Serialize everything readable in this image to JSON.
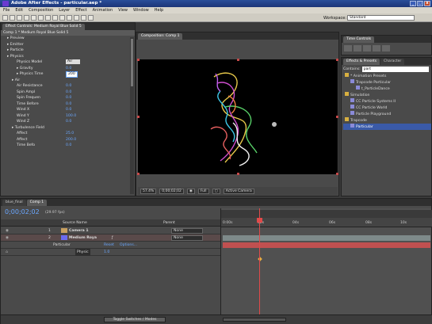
{
  "window": {
    "title": "Adobe After Effects - particular.aep *",
    "min": "_",
    "max": "□",
    "close": "x"
  },
  "menu": [
    "File",
    "Edit",
    "Composition",
    "Layer",
    "Effect",
    "Animation",
    "View",
    "Window",
    "Help"
  ],
  "toolbar": {
    "workspace_label": "Workspace:",
    "workspace_value": "Standard"
  },
  "effect_controls": {
    "tabs": [
      "Effect Controls: Medium Royal Blue Solid 5"
    ],
    "header": "Comp 1 * Medium Royal Blue Solid 5",
    "rows": [
      {
        "label": "Preview",
        "value": ""
      },
      {
        "label": "Emitter",
        "value": ""
      },
      {
        "label": "Particle",
        "value": ""
      },
      {
        "label": "Physics",
        "value": ""
      },
      {
        "label": "Physics Model",
        "value": "Air"
      },
      {
        "label": "Gravity",
        "value": "0.0"
      },
      {
        "label": "Physics Time",
        "value": "200"
      },
      {
        "label": "Air",
        "value": ""
      },
      {
        "label": "Air Resistance",
        "value": "0.0"
      },
      {
        "label": "Spin Ampl",
        "value": "0.0"
      },
      {
        "label": "Spin Frequen",
        "value": "0.0"
      },
      {
        "label": "Time Before",
        "value": "0.0"
      },
      {
        "label": "Wind X",
        "value": "0.0"
      },
      {
        "label": "Wind Y",
        "value": "100.0"
      },
      {
        "label": "Wind Z",
        "value": "0.0"
      },
      {
        "label": "Turbulence Field",
        "value": ""
      },
      {
        "label": "Affect",
        "value": "25.0"
      },
      {
        "label": "Affect",
        "value": "200.0"
      },
      {
        "label": "Time Befo",
        "value": "0.0"
      }
    ]
  },
  "composition": {
    "tabs": [
      "Composition: Comp 1"
    ],
    "zoom": "57.4%",
    "timecode": "0;00;02;02",
    "resolution": "Full",
    "camera": "Active Camera"
  },
  "time_controls": {
    "tabs": [
      "Time Controls"
    ]
  },
  "effects_presets": {
    "tabs": [
      "Effects & Presets",
      "Character"
    ],
    "search_label": "Contains:",
    "search_value": "part",
    "items": [
      {
        "label": "* Animation Presets",
        "indent": 0
      },
      {
        "label": "Trapcode Particular",
        "indent": 1
      },
      {
        "label": "t_ParticleDance",
        "indent": 2
      },
      {
        "label": "Simulation",
        "indent": 0
      },
      {
        "label": "CC Particle Systems II",
        "indent": 1
      },
      {
        "label": "CC Particle World",
        "indent": 1
      },
      {
        "label": "Particle Playground",
        "indent": 1
      },
      {
        "label": "Trapcode",
        "indent": 0
      },
      {
        "label": "Particular",
        "indent": 1
      }
    ]
  },
  "timeline": {
    "tabs": [
      "blue_final",
      "Comp 1"
    ],
    "timecode": "0;00;02;02",
    "fps": "(29.97 fps)",
    "col_source": "Source Name",
    "col_parent": "Parent",
    "ruler": [
      "0:00s",
      "02s",
      "04s",
      "06s",
      "08s",
      "10s"
    ],
    "layers": [
      {
        "num": "1",
        "name": "Camera 1",
        "parent": "None"
      },
      {
        "num": "2",
        "name": "Medium Roya",
        "parent": "None"
      }
    ],
    "effect_name": "Particular",
    "reset": "Reset",
    "options": "Options...",
    "sub_prop": "Physic",
    "sub_value": "1.0",
    "toggle": "Toggle Switches / Modes"
  },
  "colors": {
    "accent": "#3a5aa8",
    "playhead": "#e04a4a",
    "title_bar": "#1b3578"
  }
}
